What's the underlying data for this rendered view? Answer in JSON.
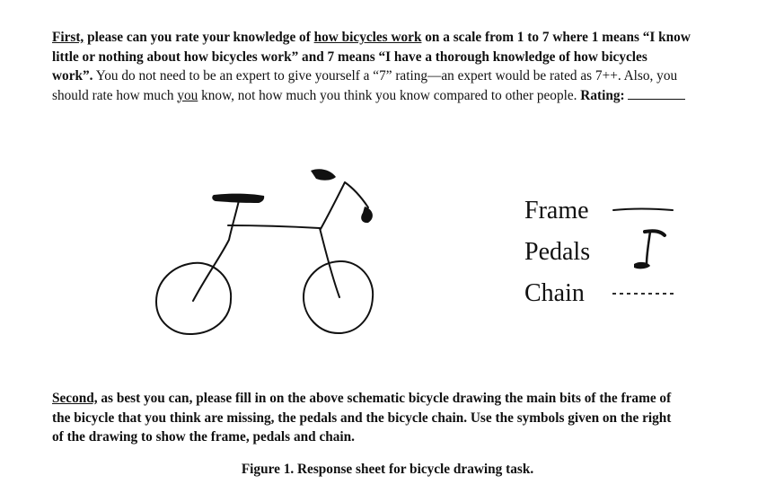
{
  "para1": {
    "first": "First,",
    "intro": " please can you rate your knowledge of ",
    "topic": "how bicycles work",
    "scale": " on a scale from 1 to 7 where 1 means “I know little or nothing about how bicycles work” and 7 means “I have a thorough knowledge of how bicycles work”.",
    "normal": " You do not need to be an expert to give yourself a “7” rating—an expert would be rated as 7++. Also, you should rate how much ",
    "you": "you",
    "tail": " know, not how much you think you know compared to other people. ",
    "rating_label": "Rating:"
  },
  "legend": {
    "frame": "Frame",
    "pedals": "Pedals",
    "chain": "Chain"
  },
  "para2": {
    "second": "Second,",
    "text": " as best you can, please fill in on the above schematic bicycle drawing the main bits of the frame of the bicycle that you think are missing, the pedals and the bicycle chain. Use the symbols given on the right of the drawing to show the frame, pedals and chain."
  },
  "caption": "Figure 1. Response sheet for bicycle drawing task."
}
